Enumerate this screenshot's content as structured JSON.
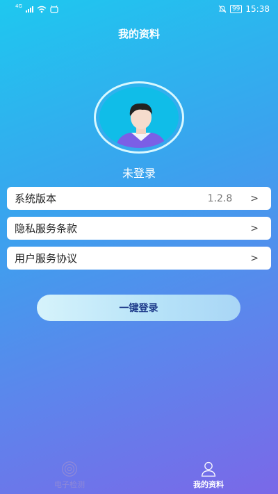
{
  "status_bar": {
    "network": "4G",
    "battery": "99",
    "time": "15:38"
  },
  "header": {
    "title": "我的资料"
  },
  "profile": {
    "login_status": "未登录"
  },
  "menu": {
    "items": [
      {
        "label": "系统版本",
        "value": "1.2.8",
        "chevron": ">"
      },
      {
        "label": "隐私服务条款",
        "value": "",
        "chevron": ">"
      },
      {
        "label": "用户服务协议",
        "value": "",
        "chevron": ">"
      }
    ]
  },
  "login_button": {
    "label": "一键登录"
  },
  "tabs": [
    {
      "label": "电子检测",
      "icon": "target-icon",
      "active": false
    },
    {
      "label": "我的资料",
      "icon": "person-icon",
      "active": true
    }
  ]
}
